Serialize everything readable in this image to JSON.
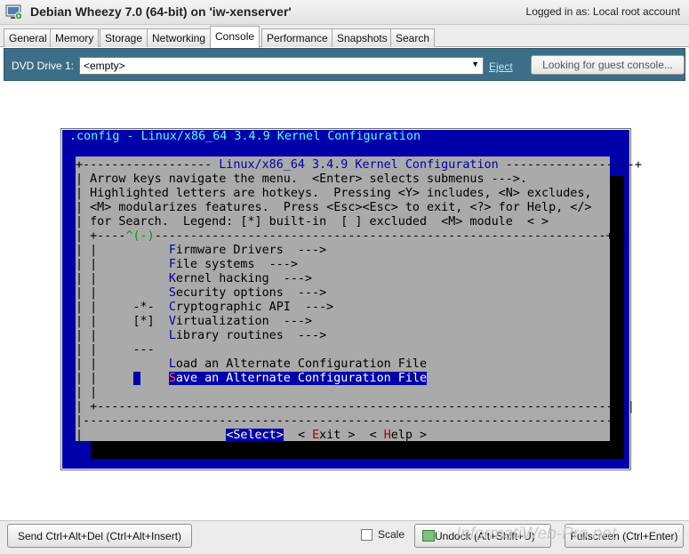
{
  "window": {
    "title": "Debian Wheezy 7.0 (64-bit) on 'iw-xenserver'",
    "login_info": "Logged in as:  Local root account"
  },
  "tabs": [
    {
      "label": "General"
    },
    {
      "label": "Memory"
    },
    {
      "label": "Storage"
    },
    {
      "label": "Networking"
    },
    {
      "label": "Console"
    },
    {
      "label": "Performance"
    },
    {
      "label": "Snapshots"
    },
    {
      "label": "Search"
    }
  ],
  "toolbar": {
    "dvd_label": "DVD Drive 1:",
    "dvd_value": "<empty>",
    "eject_label": "Eject",
    "guest_console_button": "Looking for guest console..."
  },
  "console": {
    "header": ".config - Linux/x86_64 3.4.9 Kernel Configuration",
    "dialog_title": "Linux/x86_64 3.4.9 Kernel Configuration",
    "help_lines": [
      "Arrow keys navigate the menu.  <Enter> selects submenus --->.",
      "Highlighted letters are hotkeys.  Pressing <Y> includes, <N> excludes,",
      "<M> modularizes features.  Press <Esc><Esc> to exit, <?> for Help, </>",
      "for Search.  Legend: [*] built-in  [ ] excluded  <M> module  < >"
    ],
    "scroll_indicator": "^(-)",
    "menu_items": [
      {
        "prefix": "",
        "hotkey": "F",
        "rest": "irmware Drivers  --->"
      },
      {
        "prefix": "",
        "hotkey": "F",
        "rest": "ile systems  --->"
      },
      {
        "prefix": "",
        "hotkey": "K",
        "rest": "ernel hacking  --->"
      },
      {
        "prefix": "",
        "hotkey": "S",
        "rest": "ecurity options  --->"
      },
      {
        "prefix": "-*-",
        "hotkey": "C",
        "rest": "ryptographic API  --->"
      },
      {
        "prefix": "[*]",
        "hotkey": "V",
        "rest": "irtualization  --->"
      },
      {
        "prefix": "",
        "hotkey": "L",
        "rest": "ibrary routines  --->"
      },
      {
        "prefix": "---",
        "hotkey": "",
        "rest": ""
      },
      {
        "prefix": "",
        "hotkey": "L",
        "rest": "oad an Alternate Configuration File"
      },
      {
        "prefix": "",
        "hotkey": "S",
        "rest": "ave an Alternate Configuration File"
      }
    ],
    "buttons": {
      "select": "<Select>",
      "exit_open": "< ",
      "exit_hotkey": "E",
      "exit_rest": "xit >",
      "help_open": "< ",
      "help_hotkey": "H",
      "help_rest": "elp >"
    }
  },
  "bottom": {
    "ctrl_alt_del": "Send Ctrl+Alt+Del (Ctrl+Alt+Insert)",
    "scale_label": "Scale",
    "undock_button": "Undock (Alt+Shift+U)",
    "fullscreen_button": "Fullscreen (Ctrl+Enter)",
    "watermark": "InformatiWeb-Pro.net"
  },
  "colors": {
    "console_bg": "#0000aa",
    "dialog_bg": "#aaaaaa",
    "header_text": "#55ffff",
    "toolbar_bg": "#3c6f87"
  }
}
